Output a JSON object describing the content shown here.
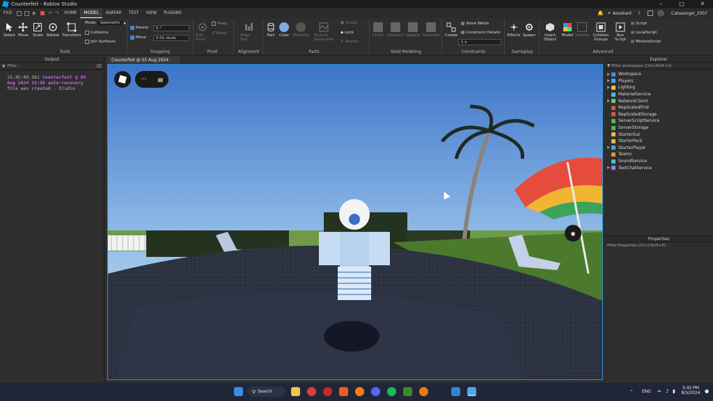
{
  "window": {
    "title": "Counterfeit - Roblox Studio"
  },
  "menubar": {
    "items": [
      "FILE",
      "HOME",
      "MODEL",
      "AVATAR",
      "TEST",
      "VIEW",
      "PLUGINS"
    ],
    "active": "MODEL",
    "assistant": "Assistant",
    "username": "Catasangel_2007"
  },
  "ribbon": {
    "tools": {
      "select": "Select",
      "move": "Move",
      "scale": "Scale",
      "rotate": "Rotate",
      "transform": "Transform",
      "group_label": "Tools"
    },
    "mode": {
      "label": "Mode:",
      "value": "Geometric",
      "collisions": "Collisions",
      "join_surfaces": "Join Surfaces"
    },
    "snapping": {
      "rotate_label": "Rotate",
      "rotate_value": "5 °",
      "move_label": "Move",
      "move_value": "0.01 studs",
      "group_label": "Snapping"
    },
    "pivot": {
      "edit_pivot": "Edit Pivot",
      "snap": "Snap",
      "reset": "Reset",
      "group_label": "Pivot"
    },
    "alignment": {
      "align_tool": "Align Tool",
      "group_label": "Alignment"
    },
    "parts": {
      "part": "Part",
      "color": "Color",
      "material": "Material",
      "texture_generator": "Texture Generator",
      "group": "Group",
      "lock": "Lock",
      "anchor": "Anchor",
      "group_label": "Parts"
    },
    "solid": {
      "union": "Union",
      "intersect": "Intersect",
      "negate": "Negate",
      "separate": "Separate",
      "group_label": "Solid Modeling"
    },
    "constraints": {
      "create": "Create",
      "show_welds": "Show Welds",
      "constraint_details": "Constraint Details",
      "scale_value": "1 x",
      "group_label": "Constraints"
    },
    "gameplay": {
      "effects": "Effects",
      "spawn": "Spawn",
      "group_label": "Gameplay"
    },
    "advanced": {
      "insert_object": "Insert Object",
      "model": "Model",
      "service": "Service",
      "collision_groups": "Collision Groups",
      "run_script": "Run Script",
      "script": "Script",
      "local_script": "LocalScript",
      "module_script": "ModuleScript",
      "group_label": "Advanced"
    }
  },
  "output": {
    "title": "Output",
    "filter_placeholder": "Filter...",
    "log_time": "15:45:09.581",
    "log_message": "Counterfeit @ 05 Aug 2024 15:45 auto-recovery file was created",
    "log_source": "- Studio"
  },
  "doc_tab": {
    "label": "Counterfeit @ 05 Aug 2024 15:45"
  },
  "explorer": {
    "title": "Explorer",
    "filter_placeholder": "Filter workspace (Ctrl+Shift+X)",
    "items": [
      {
        "label": "Workspace",
        "expandable": true,
        "color": "#3b8ee8"
      },
      {
        "label": "Players",
        "expandable": true,
        "color": "#4aa3e0"
      },
      {
        "label": "Lighting",
        "expandable": true,
        "color": "#f2c230"
      },
      {
        "label": "MaterialService",
        "expandable": false,
        "color": "#5fb3d9"
      },
      {
        "label": "NetworkClient",
        "expandable": true,
        "color": "#6cc36c"
      },
      {
        "label": "ReplicatedFirst",
        "expandable": false,
        "color": "#d9534f"
      },
      {
        "label": "ReplicatedStorage",
        "expandable": false,
        "color": "#d9534f"
      },
      {
        "label": "ServerScriptService",
        "expandable": false,
        "color": "#57b857"
      },
      {
        "label": "ServerStorage",
        "expandable": false,
        "color": "#57b857"
      },
      {
        "label": "StarterGui",
        "expandable": false,
        "color": "#e8b94a"
      },
      {
        "label": "StarterPack",
        "expandable": false,
        "color": "#e8b94a"
      },
      {
        "label": "StarterPlayer",
        "expandable": true,
        "color": "#4aa3e0"
      },
      {
        "label": "Teams",
        "expandable": false,
        "color": "#c9a227"
      },
      {
        "label": "SoundService",
        "expandable": false,
        "color": "#4ac0c0"
      },
      {
        "label": "TextChatService",
        "expandable": true,
        "color": "#9b7be3"
      }
    ]
  },
  "properties": {
    "title": "Properties",
    "filter_placeholder": "Filter Properties (Ctrl+Shift+P)"
  },
  "taskbar": {
    "search_label": "Search",
    "language": "ENG",
    "time": "3:45 PM",
    "date": "8/5/2024"
  }
}
